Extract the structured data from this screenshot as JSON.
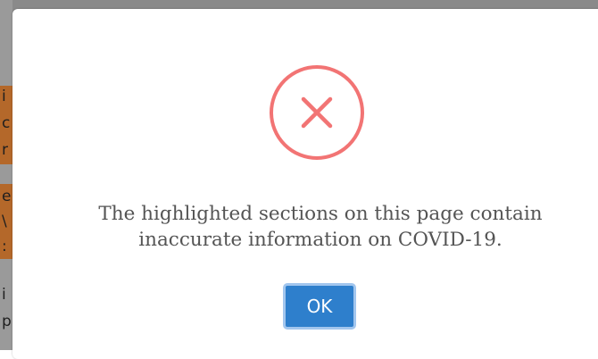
{
  "background_fragments": [
    "i",
    "c",
    "r",
    "e",
    "\\",
    ":",
    "i",
    "p"
  ],
  "dialog": {
    "icon": "error-x-icon",
    "icon_color": "#f27474",
    "message_line1": "The highlighted sections on this page contain",
    "message_line2": "inaccurate information on COVID-19.",
    "ok_label": "OK",
    "button_color": "#2e7fcc"
  },
  "highlight_color": "#b4682a"
}
